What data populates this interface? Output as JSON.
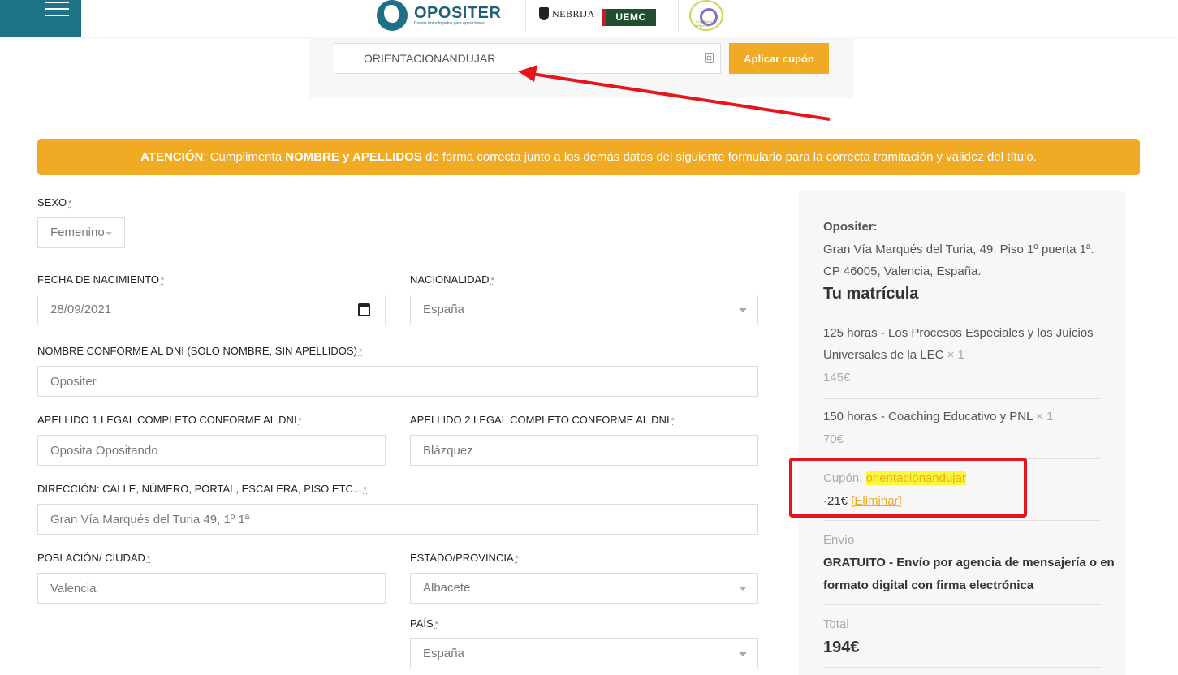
{
  "header": {
    "logo_text": "OPOSITER",
    "logo_subtitle": "Cursos homologados para oposiciones",
    "partner_nebrija": "NEBRIJA",
    "partner_uemc": "UEMC",
    "partner_confianza": "CONFIANZA ONLINE"
  },
  "coupon": {
    "value": "ORIENTACIONANDUJAR",
    "apply_label": "Aplicar cupón"
  },
  "notice": {
    "lead": "ATENCIÓN",
    "part1": ": Cumplimenta ",
    "emphasis": "NOMBRE y APELLIDOS",
    "part2": " de forma correcta junto a los demás datos del siguiente formulario para la correcta tramitación y validez del título."
  },
  "form": {
    "required_mark": "*",
    "sexo": {
      "label": "SEXO",
      "value": "Femenino"
    },
    "fecha": {
      "label": "FECHA DE NACIMIENTO",
      "value": "28/09/2021"
    },
    "nacionalidad": {
      "label": "NACIONALIDAD",
      "value": "España"
    },
    "nombre": {
      "label": "NOMBRE CONFORME AL DNI (SOLO NOMBRE, SIN APELLIDOS)",
      "value": "Opositer"
    },
    "apellido1": {
      "label": "APELLIDO 1 LEGAL COMPLETO CONFORME AL DNI",
      "value": "Oposita Opositando"
    },
    "apellido2": {
      "label": "APELLIDO 2 LEGAL COMPLETO CONFORME AL DNI",
      "value": "Blázquez"
    },
    "direccion": {
      "label": "DIRECCIÓN: CALLE, NÚMERO, PORTAL, ESCALERA, PISO ETC...",
      "value": "Gran Vía Marqués del Turia 49, 1º 1ª"
    },
    "poblacion": {
      "label": "POBLACIÓN/ CIUDAD",
      "value": "Valencia"
    },
    "provincia": {
      "label": "ESTADO/PROVINCIA",
      "value": "Albacete"
    },
    "pais": {
      "label": "PAÍS",
      "value": "España"
    }
  },
  "summary": {
    "company": "Opositer:",
    "address1": "Gran Vía Marqués del Turia, 49. Piso 1º puerta 1ª.",
    "address2": "CP 46005, Valencia, España.",
    "heading": "Tu matrícula",
    "items": [
      {
        "name_line1": "125 horas - Los Procesos Especiales y los Juicios",
        "name_line2": "Universales de la LEC",
        "qty": "× 1",
        "price": "145€"
      },
      {
        "name_line1": "150 horas - Coaching Educativo y PNL",
        "qty": "× 1",
        "price": "70€"
      }
    ],
    "coupon_label": "Cupón:",
    "coupon_code": "orientacionandujar",
    "coupon_discount": "-21€",
    "coupon_remove": "[Eliminar]",
    "shipping_label": "Envío",
    "shipping_line1": "GRATUITO - Envío por agencia de mensajería o en",
    "shipping_line2": "formato digital con firma electrónica",
    "total_label": "Total",
    "total_value": "194€"
  },
  "colors": {
    "accent": "#f0aa24",
    "header_menu": "#1f7387",
    "annotation": "#e8141b",
    "highlight": "#fbf83a"
  }
}
